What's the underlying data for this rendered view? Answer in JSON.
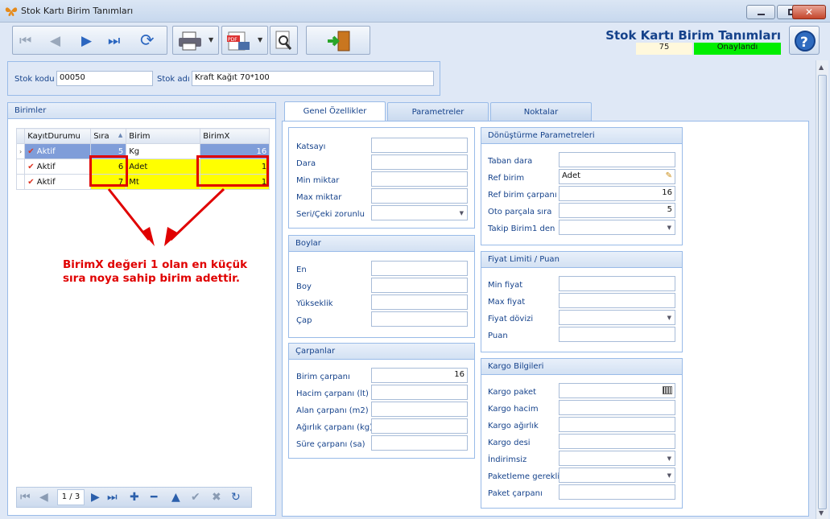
{
  "window": {
    "title": "Stok Kartı Birim Tanımları"
  },
  "header": {
    "title": "Stok Kartı Birim Tanımları",
    "number": "75",
    "status": "Onaylandı",
    "status_color": "#00ee00"
  },
  "toolbar": {
    "icons": [
      "first-icon",
      "prev-icon",
      "next-icon",
      "last-icon",
      "refresh-icon",
      "print-icon",
      "pdf-icon",
      "search-doc-icon",
      "exit-door-icon",
      "help-icon"
    ]
  },
  "stock": {
    "code_label": "Stok kodu",
    "code_value": "00050",
    "name_label": "Stok adı",
    "name_value": "Kraft Kağıt 70*100"
  },
  "units": {
    "panel_title": "Birimler",
    "columns": [
      "KayıtDurumu",
      "Sıra",
      "Birim",
      "BirimX"
    ],
    "rows": [
      {
        "status": "Aktif",
        "order": "5",
        "unit": "Kg",
        "x": "16"
      },
      {
        "status": "Aktif",
        "order": "6",
        "unit": "Adet",
        "x": "1"
      },
      {
        "status": "Aktif",
        "order": "7",
        "unit": "Mt",
        "x": "1"
      }
    ],
    "pager": "1 / 3"
  },
  "annotation": {
    "text": "BirimX değeri 1 olan en küçük sıra noya sahip birim adettir."
  },
  "tabs": [
    "Genel Özellikler",
    "Parametreler",
    "Noktalar"
  ],
  "general": {
    "fields": [
      "Katsayı",
      "Dara",
      "Min miktar",
      "Max miktar",
      "Seri/Çeki zorunlu"
    ]
  },
  "boylar": {
    "title": "Boylar",
    "fields": [
      "En",
      "Boy",
      "Yükseklik",
      "Çap"
    ]
  },
  "carpanlar": {
    "title": "Çarpanlar",
    "fields": [
      "Birim çarpanı",
      "Hacim çarpanı (lt)",
      "Alan çarpanı (m2)",
      "Ağırlık çarpanı (kg)",
      "Süre çarpanı (sa)"
    ],
    "birim_carpani": "16"
  },
  "donusturme": {
    "title": "Dönüştürme Parametreleri",
    "fields": [
      "Taban dara",
      "Ref birim",
      "Ref birim çarpanı",
      "Oto parçala sıra",
      "Takip Birim1 den"
    ],
    "ref_birim": "Adet",
    "ref_birim_carpani": "16",
    "oto_parcala": "5"
  },
  "fiyat": {
    "title": "Fiyat Limiti / Puan",
    "fields": [
      "Min fiyat",
      "Max fiyat",
      "Fiyat dövizi",
      "Puan"
    ]
  },
  "kargo": {
    "title": "Kargo Bilgileri",
    "fields": [
      "Kargo paket",
      "Kargo hacim",
      "Kargo ağırlık",
      "Kargo desi",
      "İndirimsiz",
      "Paketleme gerekli",
      "Paket çarpanı"
    ]
  }
}
